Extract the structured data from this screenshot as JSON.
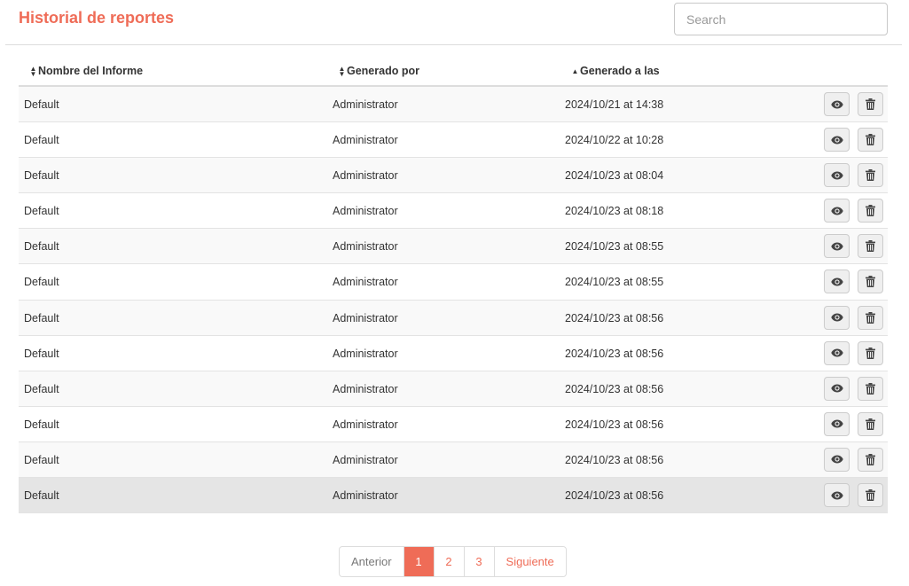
{
  "header": {
    "title": "Historial de reportes",
    "search_placeholder": "Search"
  },
  "table": {
    "columns": [
      {
        "label": "Nombre del Informe",
        "sort": "both"
      },
      {
        "label": "Generado por",
        "sort": "both"
      },
      {
        "label": "Generado a las",
        "sort": "asc"
      }
    ],
    "rows": [
      {
        "name": "Default",
        "by": "Administrator",
        "at": "2024/10/21 at 14:38"
      },
      {
        "name": "Default",
        "by": "Administrator",
        "at": "2024/10/22 at 10:28"
      },
      {
        "name": "Default",
        "by": "Administrator",
        "at": "2024/10/23 at 08:04"
      },
      {
        "name": "Default",
        "by": "Administrator",
        "at": "2024/10/23 at 08:18"
      },
      {
        "name": "Default",
        "by": "Administrator",
        "at": "2024/10/23 at 08:55"
      },
      {
        "name": "Default",
        "by": "Administrator",
        "at": "2024/10/23 at 08:55"
      },
      {
        "name": "Default",
        "by": "Administrator",
        "at": "2024/10/23 at 08:56"
      },
      {
        "name": "Default",
        "by": "Administrator",
        "at": "2024/10/23 at 08:56"
      },
      {
        "name": "Default",
        "by": "Administrator",
        "at": "2024/10/23 at 08:56"
      },
      {
        "name": "Default",
        "by": "Administrator",
        "at": "2024/10/23 at 08:56"
      },
      {
        "name": "Default",
        "by": "Administrator",
        "at": "2024/10/23 at 08:56"
      },
      {
        "name": "Default",
        "by": "Administrator",
        "at": "2024/10/23 at 08:56"
      }
    ],
    "hovered_row": 11,
    "row_actions": [
      {
        "icon": "eye-icon"
      },
      {
        "icon": "trash-icon"
      }
    ]
  },
  "pagination": {
    "previous_label": "Anterior",
    "pages": [
      "1",
      "2",
      "3"
    ],
    "active_page": "1",
    "next_label": "Siguiente"
  },
  "colors": {
    "accent": "#ef6c57",
    "row_stripe": "#f9f9f9",
    "row_hover": "#e5e5e5"
  }
}
